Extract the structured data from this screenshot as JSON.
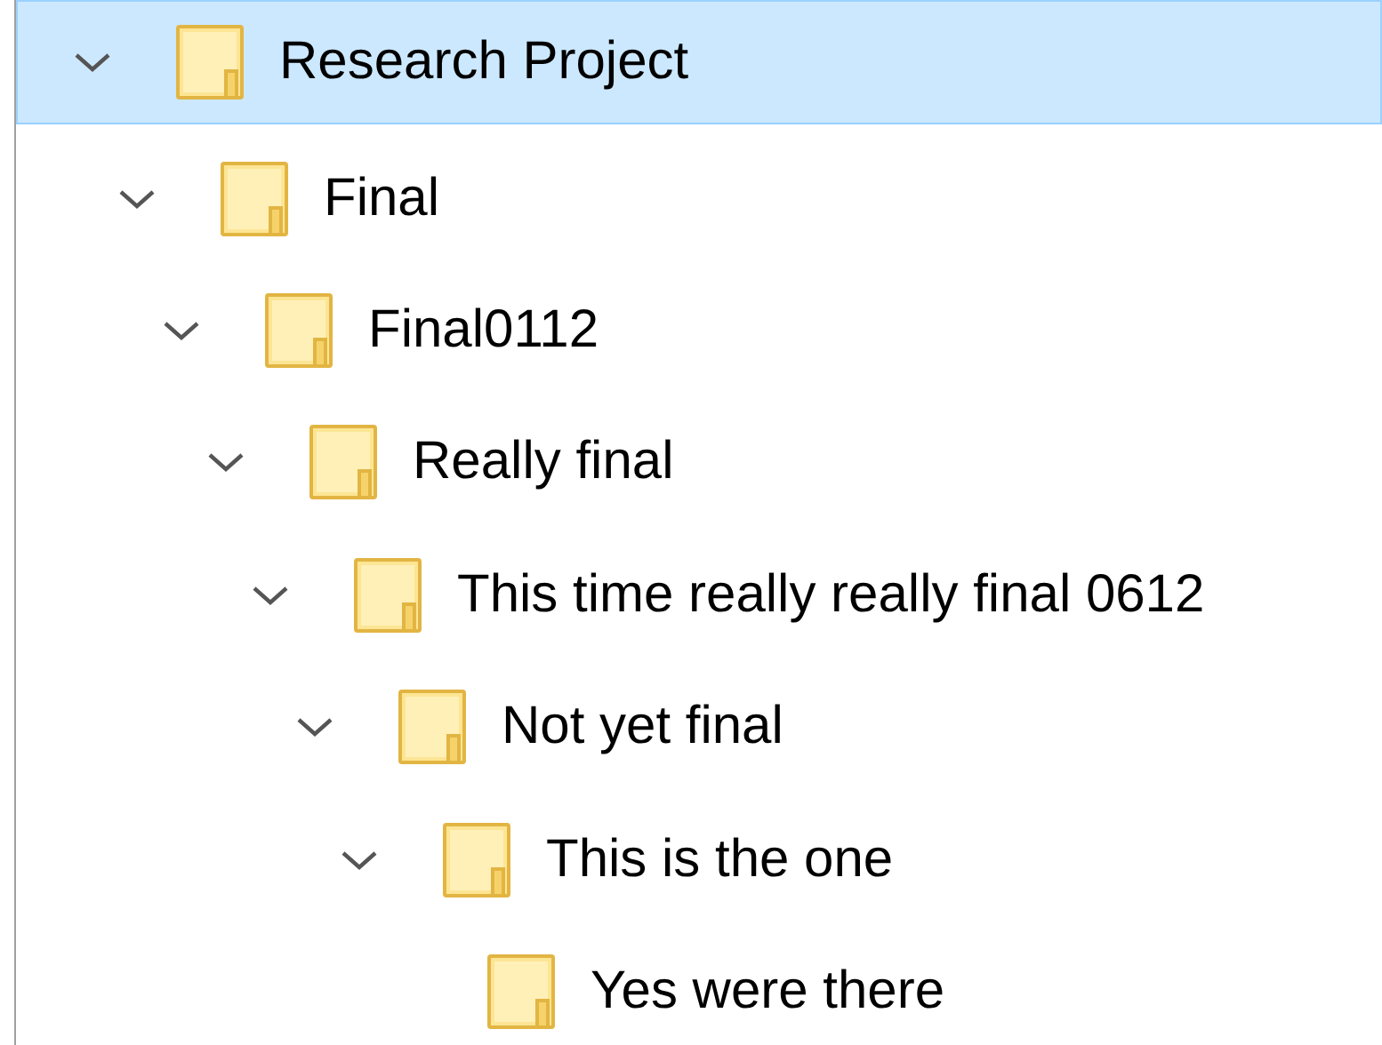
{
  "tree": [
    {
      "label": "Research Project",
      "selected": true,
      "expanded": true,
      "children": [
        {
          "label": "Final",
          "selected": false,
          "expanded": true,
          "children": [
            {
              "label": "Final0112",
              "selected": false,
              "expanded": true,
              "children": [
                {
                  "label": "Really final",
                  "selected": false,
                  "expanded": true,
                  "children": [
                    {
                      "label": "This time really really final 0612",
                      "selected": false,
                      "expanded": true,
                      "children": [
                        {
                          "label": "Not yet final",
                          "selected": false,
                          "expanded": true,
                          "children": [
                            {
                              "label": "This is the one",
                              "selected": false,
                              "expanded": true,
                              "children": [
                                {
                                  "label": "Yes were there",
                                  "selected": false
                                }
                              ]
                            }
                          ]
                        }
                      ]
                    }
                  ]
                }
              ]
            }
          ]
        }
      ]
    }
  ]
}
